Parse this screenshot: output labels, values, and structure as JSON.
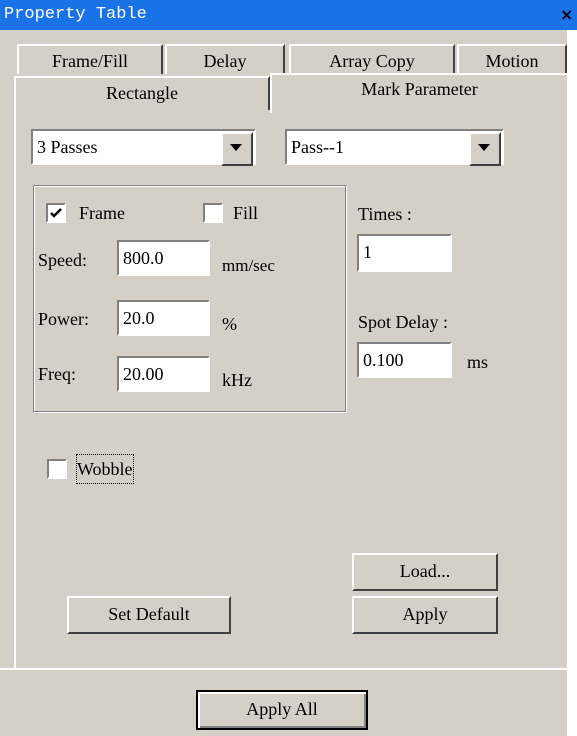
{
  "window": {
    "title": "Property Table",
    "close_label": "×"
  },
  "tabs": {
    "row1": [
      "Frame/Fill",
      "Delay",
      "Array Copy",
      "Motion"
    ],
    "row2": [
      "Rectangle",
      "Mark Parameter"
    ],
    "active": "Mark Parameter"
  },
  "mark": {
    "passes_select": "3 Passes",
    "pass_select": "Pass--1",
    "frame_label": "Frame",
    "frame_checked": true,
    "fill_label": "Fill",
    "fill_checked": false,
    "speed_label": "Speed:",
    "speed_value": "800.0",
    "speed_unit": "mm/sec",
    "power_label": "Power:",
    "power_value": "20.0",
    "power_unit": "%",
    "freq_label": "Freq:",
    "freq_value": "20.00",
    "freq_unit": "kHz",
    "times_label": "Times :",
    "times_value": "1",
    "spot_delay_label": "Spot Delay :",
    "spot_delay_value": "0.100",
    "spot_delay_unit": "ms",
    "wobble_label": "Wobble",
    "wobble_checked": false
  },
  "buttons": {
    "load": "Load...",
    "set_default": "Set Default",
    "apply": "Apply",
    "apply_all": "Apply All"
  }
}
